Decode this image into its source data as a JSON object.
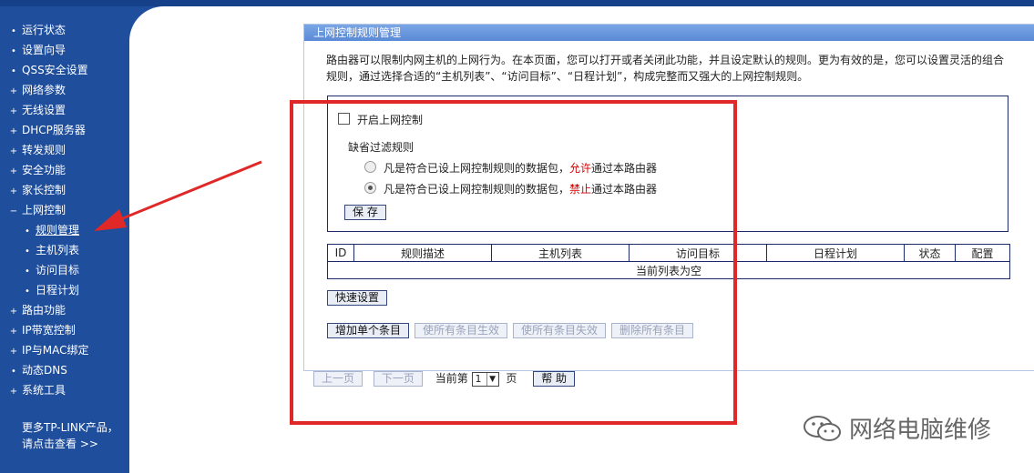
{
  "sidebar": {
    "items": [
      {
        "mark": "•",
        "label": "运行状态"
      },
      {
        "mark": "•",
        "label": "设置向导"
      },
      {
        "mark": "•",
        "label": "QSS安全设置"
      },
      {
        "mark": "+",
        "label": "网络参数"
      },
      {
        "mark": "+",
        "label": "无线设置"
      },
      {
        "mark": "+",
        "label": "DHCP服务器"
      },
      {
        "mark": "+",
        "label": "转发规则"
      },
      {
        "mark": "+",
        "label": "安全功能"
      },
      {
        "mark": "+",
        "label": "家长控制"
      },
      {
        "mark": "−",
        "label": "上网控制"
      },
      {
        "mark": "•",
        "label": "规则管理"
      },
      {
        "mark": "•",
        "label": "主机列表"
      },
      {
        "mark": "•",
        "label": "访问目标"
      },
      {
        "mark": "•",
        "label": "日程计划"
      },
      {
        "mark": "+",
        "label": "路由功能"
      },
      {
        "mark": "+",
        "label": "IP带宽控制"
      },
      {
        "mark": "+",
        "label": "IP与MAC绑定"
      },
      {
        "mark": "•",
        "label": "动态DNS"
      },
      {
        "mark": "+",
        "label": "系统工具"
      }
    ],
    "more_line1": "更多TP-LINK产品，",
    "more_line2": "请点击查看 >>"
  },
  "panel": {
    "title": "上网控制规则管理",
    "intro": "路由器可以限制内网主机的上网行为。在本页面，您可以打开或者关闭此功能，并且设定默认的规则。更为有效的是，您可以设置灵活的组合规则，通过选择合适的“主机列表”、“访问目标”、“日程计划”，构成完整而又强大的上网控制规则。",
    "enable_label": "开启上网控制",
    "default_rule_label": "缺省过滤规则",
    "rule_prefix": "凡是符合已设上网控制规则的数据包，",
    "allow_word": "允许",
    "deny_word": "禁止",
    "rule_suffix": "通过本路由器",
    "save_button": "保 存"
  },
  "table": {
    "headers": [
      "ID",
      "规则描述",
      "主机列表",
      "访问目标",
      "日程计划",
      "状态",
      "配置"
    ],
    "empty_text": "当前列表为空"
  },
  "actions": {
    "quick_setup": "快速设置",
    "add_entry": "增加单个条目",
    "enable_all": "使所有条目生效",
    "disable_all": "使所有条目失效",
    "delete_all": "删除所有条目"
  },
  "pager": {
    "prev": "上一页",
    "next": "下一页",
    "current_label": "当前第",
    "page_value": "1",
    "page_suffix": "页",
    "help": "帮 助"
  },
  "annotation": {
    "frame_color": "#e02828"
  },
  "watermark": {
    "text": "网络电脑维修"
  }
}
